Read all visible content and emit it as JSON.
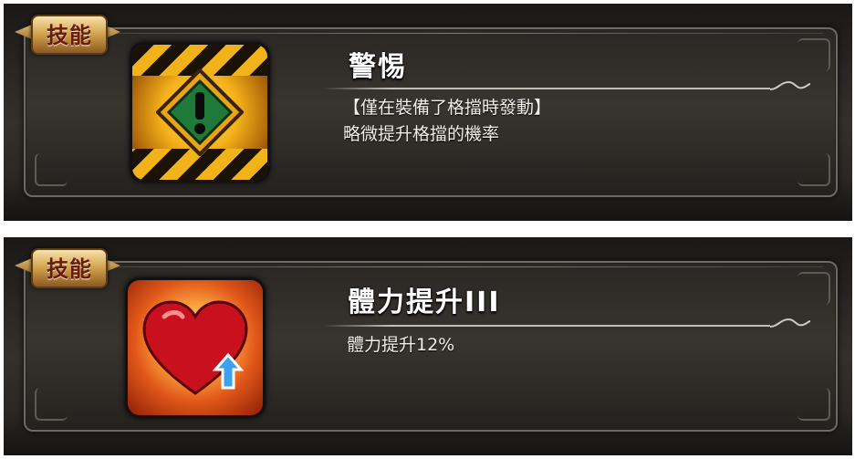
{
  "badge_label": "技能",
  "skills": [
    {
      "name": "警惕",
      "icon": "warning-sign-icon",
      "lines": [
        "【僅在裝備了格擋時發動】",
        "略微提升格擋的機率"
      ]
    },
    {
      "name": "體力提升III",
      "icon": "heart-up-arrow-icon",
      "lines": [
        "體力提升12%"
      ]
    }
  ],
  "colors": {
    "panel": "#2e2b27",
    "title": "#ffffff",
    "badge_gold": "#d6a651",
    "badge_text": "#6a1a10"
  }
}
